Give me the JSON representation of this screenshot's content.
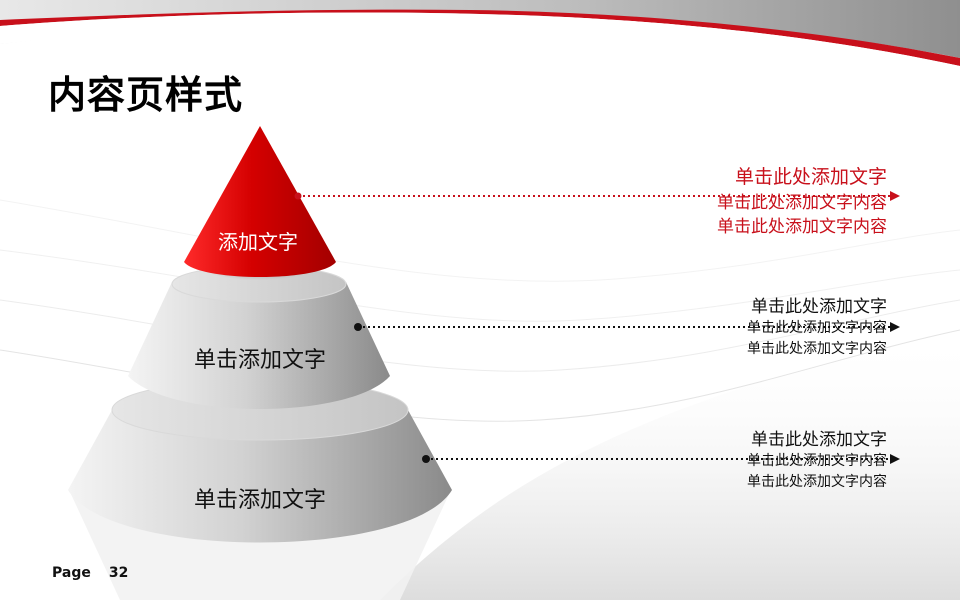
{
  "slide": {
    "title": "内容页样式",
    "page_label": "Page",
    "page_number": "32"
  },
  "pyramid": {
    "tiers": [
      {
        "label": "添加文字"
      },
      {
        "label": "单击添加文字"
      },
      {
        "label": "单击添加文字"
      }
    ]
  },
  "text_blocks": [
    {
      "lines": [
        "单击此处添加文字",
        "单击此处添加文字内容",
        "单击此处添加文字内容"
      ]
    },
    {
      "lines": [
        "单击此处添加文字",
        "单击此处添加文字内容",
        "单击此处添加文字内容"
      ]
    },
    {
      "lines": [
        "单击此处添加文字",
        "单击此处添加文字内容",
        "单击此处添加文字内容"
      ]
    }
  ],
  "colors": {
    "accent_red": "#c8101b",
    "connector_dark": "#111111"
  }
}
